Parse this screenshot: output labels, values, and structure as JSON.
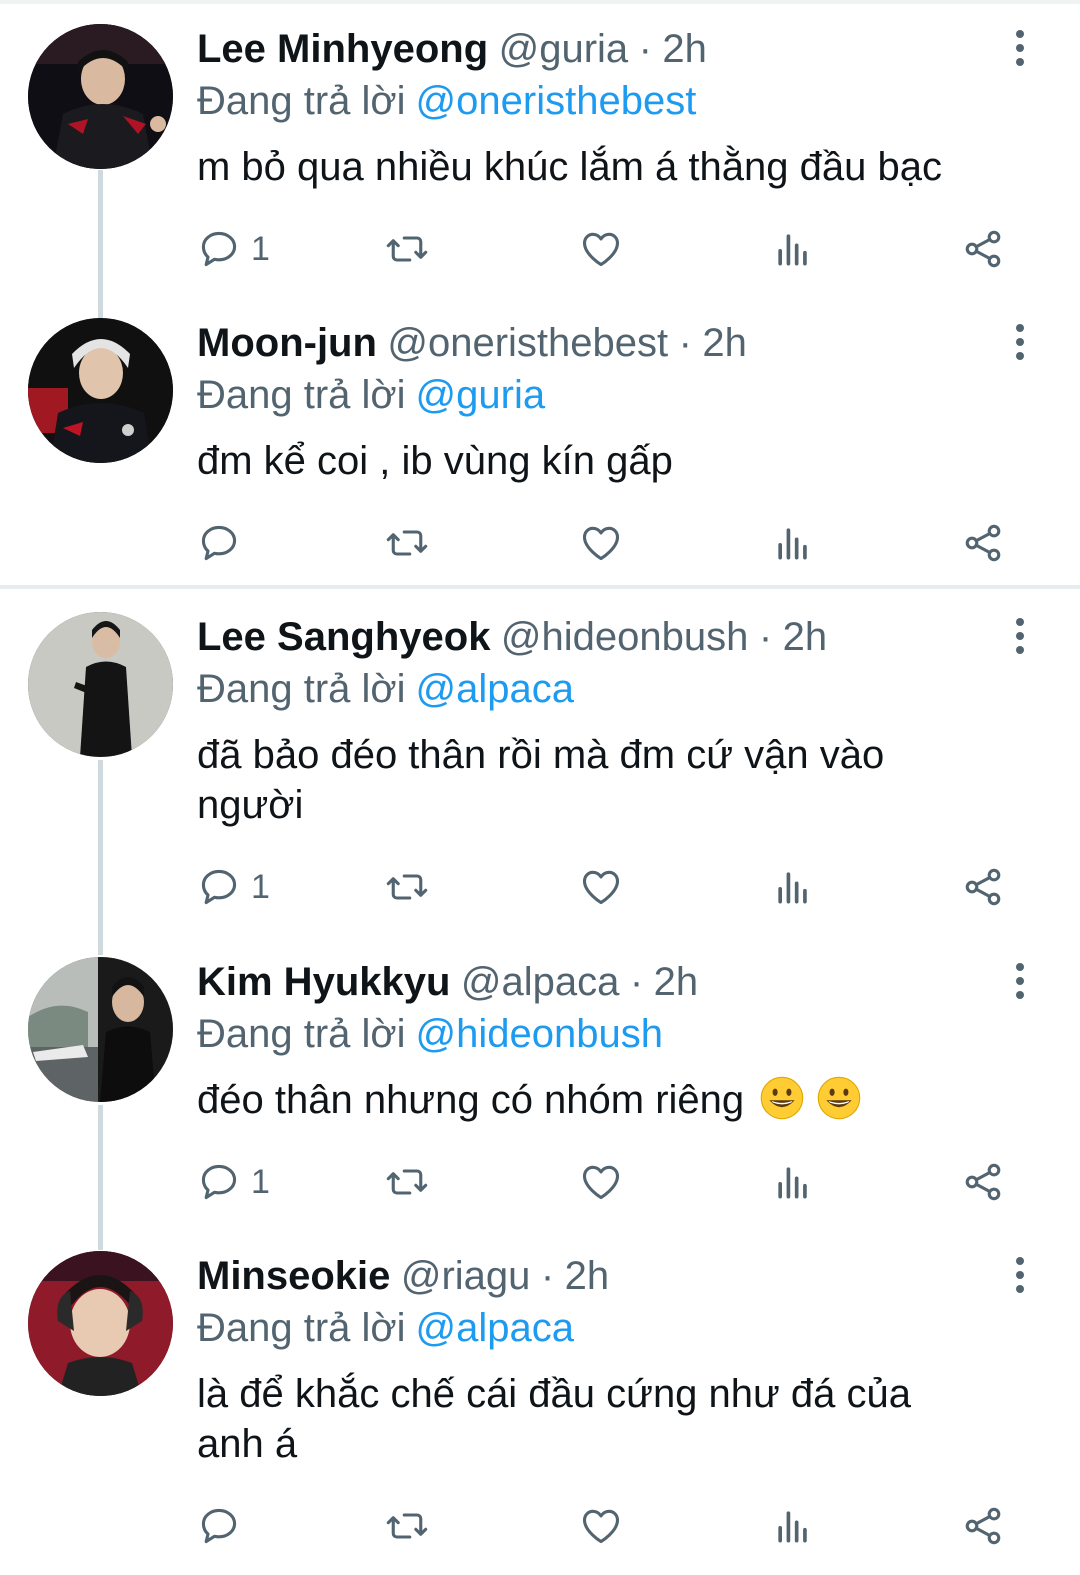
{
  "reply_prefix": "Đang trả lời",
  "tweets": [
    {
      "name": "Lee Minhyeong",
      "handle": "@guria",
      "separator": "·",
      "time": "2h",
      "reply_to": "@oneristhebest",
      "text": "m bỏ qua nhiều khúc lắm á thằng đầu bạc",
      "reply_count": "1",
      "avatar_icon": "avatar-photo-icon"
    },
    {
      "name": "Moon-jun",
      "handle": "@oneristhebest",
      "separator": "·",
      "time": "2h",
      "reply_to": "@guria",
      "text": "đm kể coi , ib vùng kín gấp",
      "reply_count": "",
      "avatar_icon": "avatar-photo-icon"
    },
    {
      "name": "Lee Sanghyeok",
      "handle": "@hideonbush",
      "separator": "·",
      "time": "2h",
      "reply_to": "@alpaca",
      "text": "đã bảo đéo thân rồi mà đm cứ vận vào người",
      "reply_count": "1",
      "avatar_icon": "avatar-photo-icon"
    },
    {
      "name": "Kim Hyukkyu",
      "handle": "@alpaca",
      "separator": "·",
      "time": "2h",
      "reply_to": "@hideonbush",
      "text": "đéo thân nhưng có nhóm riêng",
      "reply_count": "1",
      "emoji": [
        "grinning-face-emoji",
        "grinning-face-emoji"
      ],
      "avatar_icon": "avatar-photo-icon"
    },
    {
      "name": "Minseokie",
      "handle": "@riagu",
      "separator": "·",
      "time": "2h",
      "reply_to": "@alpaca",
      "text": "là để khắc chế cái đầu cứng như đá của anh á",
      "reply_count": "",
      "avatar_icon": "avatar-photo-icon"
    }
  ],
  "colors": {
    "primary_text": "#0f1419",
    "secondary_text": "#536471",
    "link": "#1d9bf0",
    "thread_line": "#cfd9de"
  }
}
